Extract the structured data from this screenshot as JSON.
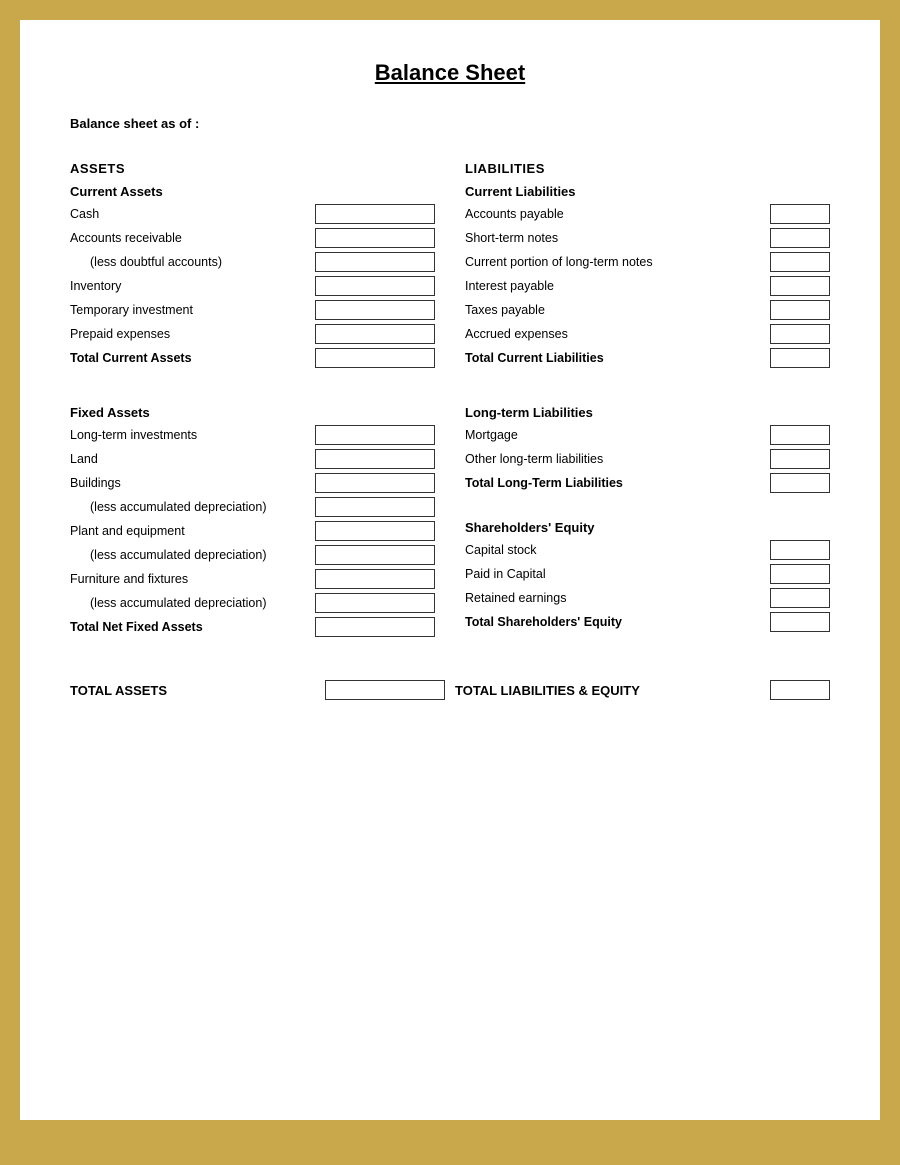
{
  "title": "Balance Sheet",
  "subtitle": "Balance sheet as of :",
  "assets": {
    "header": "ASSETS",
    "currentAssets": {
      "header": "Current Assets",
      "items": [
        {
          "label": "Cash",
          "indented": false
        },
        {
          "label": "Accounts receivable",
          "indented": false
        },
        {
          "label": "(less doubtful accounts)",
          "indented": true
        },
        {
          "label": "Inventory",
          "indented": false
        },
        {
          "label": "Temporary investment",
          "indented": false
        },
        {
          "label": "Prepaid expenses",
          "indented": false
        }
      ],
      "total": "Total Current Assets"
    },
    "fixedAssets": {
      "header": "Fixed Assets",
      "items": [
        {
          "label": "Long-term investments",
          "indented": false
        },
        {
          "label": "Land",
          "indented": false
        },
        {
          "label": "Buildings",
          "indented": false
        },
        {
          "label": "(less accumulated depreciation)",
          "indented": true
        },
        {
          "label": "Plant and equipment",
          "indented": false
        },
        {
          "label": "(less accumulated depreciation)",
          "indented": true
        },
        {
          "label": "Furniture and fixtures",
          "indented": false
        },
        {
          "label": "(less accumulated depreciation)",
          "indented": true
        }
      ],
      "total": "Total Net Fixed Assets"
    },
    "total": "TOTAL ASSETS"
  },
  "liabilities": {
    "header": "LIABILITIES",
    "currentLiabilities": {
      "header": "Current Liabilities",
      "items": [
        {
          "label": "Accounts payable"
        },
        {
          "label": "Short-term notes"
        },
        {
          "label": "Current portion of long-term notes"
        },
        {
          "label": "Interest payable"
        },
        {
          "label": "Taxes payable"
        },
        {
          "label": "Accrued expenses"
        }
      ],
      "total": "Total Current Liabilities"
    },
    "longTermLiabilities": {
      "header": "Long-term Liabilities",
      "items": [
        {
          "label": "Mortgage"
        },
        {
          "label": "Other long-term liabilities"
        }
      ],
      "total": "Total Long-Term Liabilities"
    },
    "shareholdersEquity": {
      "header": "Shareholders' Equity",
      "items": [
        {
          "label": "Capital stock"
        },
        {
          "label": "Paid in Capital"
        },
        {
          "label": "Retained earnings"
        }
      ],
      "total": "Total Shareholders' Equity"
    },
    "total": "TOTAL LIABILITIES & EQUITY"
  }
}
